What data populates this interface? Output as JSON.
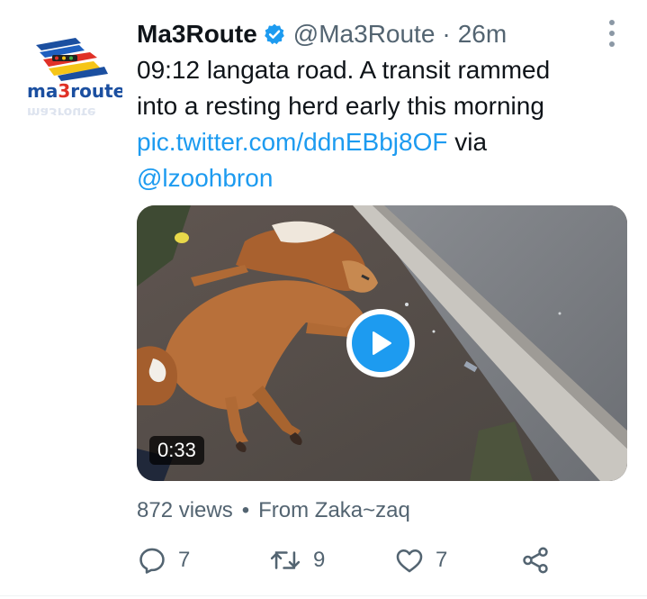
{
  "tweet": {
    "avatar": {
      "name": "ma3route-logo",
      "wordmark": "ma3route"
    },
    "display_name": "Ma3Route",
    "handle": "@Ma3Route",
    "separator": "·",
    "time": "26m",
    "text_line1": "09:12 langata road. A transit rammed",
    "text_line2": "into a resting herd early this morning",
    "link_pic": "pic.twitter.com/ddnEBbj8OF",
    "via_word": " via",
    "link_user": "@lzoohbron",
    "media": {
      "type": "video",
      "duration": "0:33"
    },
    "views": "872 views",
    "meta_separator": "•",
    "source": "From Zaka~zaq",
    "actions": {
      "replies": "7",
      "retweets": "9",
      "likes": "7"
    }
  },
  "colors": {
    "accent": "#1d9bf0",
    "text": "#0f1419",
    "secondary": "#536471"
  },
  "icons": [
    "verified-badge-icon",
    "more-options-icon",
    "play-icon",
    "reply-icon",
    "retweet-icon",
    "like-icon",
    "share-icon"
  ]
}
